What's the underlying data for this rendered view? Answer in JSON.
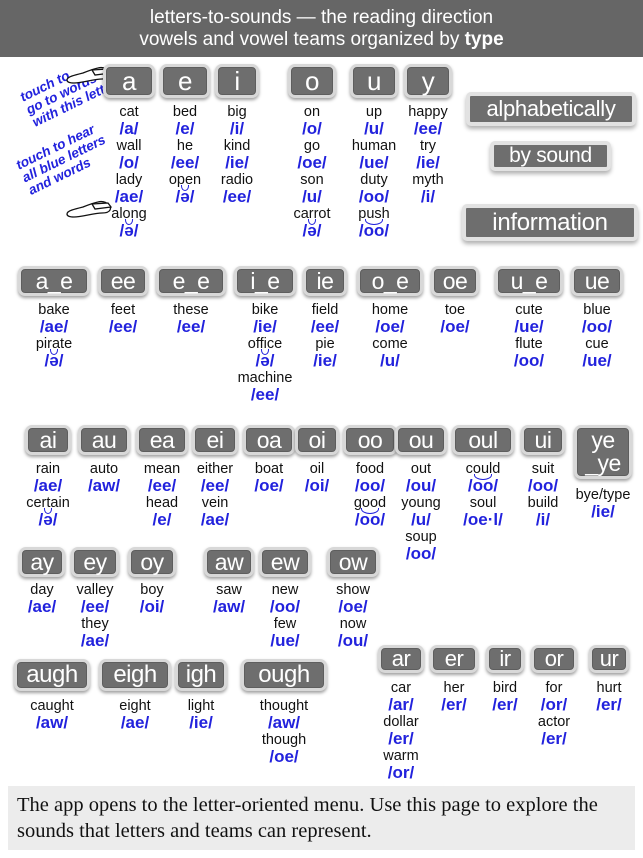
{
  "header": {
    "line1": "letters-to-sounds — the reading direction",
    "line2_pre": "vowels and vowel teams organized by ",
    "line2_strong": "type"
  },
  "footer": {
    "text": "The app opens to the letter-oriented menu. Use this page to explore the sounds that letters and teams can represent."
  },
  "hints": [
    {
      "lines": "touch to\ngo to words\nwith this letter",
      "icon": "pointing-hand-icon"
    },
    {
      "lines": "touch to hear\nall blue letters\nand words",
      "icon": "pointing-hand-icon"
    }
  ],
  "menu_buttons": [
    {
      "label": "alphabetically"
    },
    {
      "label": "by sound"
    },
    {
      "label": "information"
    }
  ],
  "colors": {
    "header_bg": "#666666",
    "tile_bg": "#6e6e6e",
    "tile_border": "#d8d8d8",
    "sound_blue": "#2222dd",
    "word_black": "#111111",
    "footer_bg": "#ececec"
  },
  "rows": [
    {
      "name": "single-vowels",
      "columns": [
        {
          "tile": "a",
          "entries": [
            {
              "word": "cat",
              "sound": "/a/"
            },
            {
              "word": "wall",
              "sound": "/o/"
            },
            {
              "word": "lady",
              "sound": "/ae/"
            },
            {
              "word": "along",
              "sound": "/ə/",
              "breve": true
            }
          ]
        },
        {
          "tile": "e",
          "entries": [
            {
              "word": "bed",
              "sound": "/e/"
            },
            {
              "word": "he",
              "sound": "/ee/"
            },
            {
              "word": "open",
              "sound": "/ə/",
              "breve": true
            }
          ]
        },
        {
          "tile": "i",
          "entries": [
            {
              "word": "big",
              "sound": "/i/"
            },
            {
              "word": "kind",
              "sound": "/ie/"
            },
            {
              "word": "radio",
              "sound": "/ee/"
            }
          ]
        },
        {
          "tile": "o",
          "entries": [
            {
              "word": "on",
              "sound": "/o/"
            },
            {
              "word": "go",
              "sound": "/oe/"
            },
            {
              "word": "son",
              "sound": "/u/"
            },
            {
              "word": "carrot",
              "sound": "/ə/",
              "breve": true
            }
          ]
        },
        {
          "tile": "u",
          "entries": [
            {
              "word": "up",
              "sound": "/u/"
            },
            {
              "word": "human",
              "sound": "/ue/"
            },
            {
              "word": "duty",
              "sound": "/oo/"
            },
            {
              "word": "push",
              "sound": "/oo/",
              "breve": true
            }
          ]
        },
        {
          "tile": "y",
          "entries": [
            {
              "word": "happy",
              "sound": "/ee/"
            },
            {
              "word": "try",
              "sound": "/ie/"
            },
            {
              "word": "myth",
              "sound": "/i/"
            }
          ]
        }
      ]
    },
    {
      "name": "split-digraphs",
      "columns": [
        {
          "tile": "a_e",
          "entries": [
            {
              "word": "bake",
              "sound": "/ae/"
            },
            {
              "word": "pirate",
              "sound": "/ə/",
              "breve": true
            }
          ]
        },
        {
          "tile": "ee",
          "entries": [
            {
              "word": "feet",
              "sound": "/ee/"
            }
          ]
        },
        {
          "tile": "e_e",
          "entries": [
            {
              "word": "these",
              "sound": "/ee/"
            }
          ]
        },
        {
          "tile": "i_e",
          "entries": [
            {
              "word": "bike",
              "sound": "/ie/"
            },
            {
              "word": "office",
              "sound": "/ə/",
              "breve": true
            },
            {
              "word": "machine",
              "sound": "/ee/"
            }
          ]
        },
        {
          "tile": "ie",
          "entries": [
            {
              "word": "field",
              "sound": "/ee/"
            },
            {
              "word": "pie",
              "sound": "/ie/"
            }
          ]
        },
        {
          "tile": "o_e",
          "entries": [
            {
              "word": "home",
              "sound": "/oe/"
            },
            {
              "word": "come",
              "sound": "/u/"
            }
          ]
        },
        {
          "tile": "oe",
          "entries": [
            {
              "word": "toe",
              "sound": "/oe/"
            }
          ]
        },
        {
          "tile": "u_e",
          "entries": [
            {
              "word": "cute",
              "sound": "/ue/"
            },
            {
              "word": "flute",
              "sound": "/oo/"
            }
          ]
        },
        {
          "tile": "ue",
          "entries": [
            {
              "word": "blue",
              "sound": "/oo/"
            },
            {
              "word": "cue",
              "sound": "/ue/"
            }
          ]
        }
      ]
    },
    {
      "name": "vowel-teams",
      "columns": [
        {
          "tile": "ai",
          "entries": [
            {
              "word": "rain",
              "sound": "/ae/"
            },
            {
              "word": "certain",
              "sound": "/ə/",
              "breve": true
            }
          ]
        },
        {
          "tile": "au",
          "entries": [
            {
              "word": "auto",
              "sound": "/aw/"
            }
          ]
        },
        {
          "tile": "ea",
          "entries": [
            {
              "word": "mean",
              "sound": "/ee/"
            },
            {
              "word": "head",
              "sound": "/e/"
            }
          ]
        },
        {
          "tile": "ei",
          "entries": [
            {
              "word": "either",
              "sound": "/ee/"
            },
            {
              "word": "vein",
              "sound": "/ae/"
            }
          ]
        },
        {
          "tile": "oa",
          "entries": [
            {
              "word": "boat",
              "sound": "/oe/"
            }
          ]
        },
        {
          "tile": "oi",
          "entries": [
            {
              "word": "oil",
              "sound": "/oi/"
            }
          ]
        },
        {
          "tile": "oo",
          "entries": [
            {
              "word": "food",
              "sound": "/oo/"
            },
            {
              "word": "good",
              "sound": "/oo/",
              "breve": true
            }
          ]
        },
        {
          "tile": "ou",
          "entries": [
            {
              "word": "out",
              "sound": "/ou/"
            },
            {
              "word": "young",
              "sound": "/u/"
            },
            {
              "word": "soup",
              "sound": "/oo/"
            }
          ]
        },
        {
          "tile": "oul",
          "entries": [
            {
              "word": "could",
              "sound": "/oo/",
              "breve": true
            },
            {
              "word": "soul",
              "sound": "/oe·l/"
            }
          ]
        },
        {
          "tile": "ui",
          "entries": [
            {
              "word": "suit",
              "sound": "/oo/"
            },
            {
              "word": "build",
              "sound": "/i/"
            }
          ]
        },
        {
          "tile": "ye\n_ye",
          "tile_l1": "ye",
          "tile_l2": "_ye",
          "entries": [
            {
              "word": "bye/type",
              "sound": "/ie/"
            }
          ]
        }
      ]
    },
    {
      "name": "y-and-w-teams",
      "columns": [
        {
          "tile": "ay",
          "entries": [
            {
              "word": "day",
              "sound": "/ae/"
            }
          ]
        },
        {
          "tile": "ey",
          "entries": [
            {
              "word": "valley",
              "sound": "/ee/"
            },
            {
              "word": "they",
              "sound": "/ae/"
            }
          ]
        },
        {
          "tile": "oy",
          "entries": [
            {
              "word": "boy",
              "sound": "/oi/"
            }
          ]
        },
        {
          "tile": "aw",
          "entries": [
            {
              "word": "saw",
              "sound": "/aw/"
            }
          ]
        },
        {
          "tile": "ew",
          "entries": [
            {
              "word": "new",
              "sound": "/oo/"
            },
            {
              "word": "few",
              "sound": "/ue/"
            }
          ]
        },
        {
          "tile": "ow",
          "entries": [
            {
              "word": "show",
              "sound": "/oe/"
            },
            {
              "word": "now",
              "sound": "/ou/"
            }
          ]
        }
      ]
    },
    {
      "name": "gh-teams",
      "columns": [
        {
          "tile": "augh",
          "entries": [
            {
              "word": "caught",
              "sound": "/aw/"
            }
          ]
        },
        {
          "tile": "eigh",
          "entries": [
            {
              "word": "eight",
              "sound": "/ae/"
            }
          ]
        },
        {
          "tile": "igh",
          "entries": [
            {
              "word": "light",
              "sound": "/ie/"
            }
          ]
        },
        {
          "tile": "ough",
          "entries": [
            {
              "word": "thought",
              "sound": "/aw/"
            },
            {
              "word": "though",
              "sound": "/oe/"
            }
          ]
        }
      ]
    },
    {
      "name": "r-controlled",
      "columns": [
        {
          "tile": "ar",
          "entries": [
            {
              "word": "car",
              "sound": "/ar/"
            },
            {
              "word": "dollar",
              "sound": "/er/"
            },
            {
              "word": "warm",
              "sound": "/or/"
            }
          ]
        },
        {
          "tile": "er",
          "entries": [
            {
              "word": "her",
              "sound": "/er/"
            }
          ]
        },
        {
          "tile": "ir",
          "entries": [
            {
              "word": "bird",
              "sound": "/er/"
            }
          ]
        },
        {
          "tile": "or",
          "entries": [
            {
              "word": "for",
              "sound": "/or/"
            },
            {
              "word": "actor",
              "sound": "/er/"
            }
          ]
        },
        {
          "tile": "ur",
          "entries": [
            {
              "word": "hurt",
              "sound": "/er/"
            }
          ]
        }
      ]
    }
  ]
}
